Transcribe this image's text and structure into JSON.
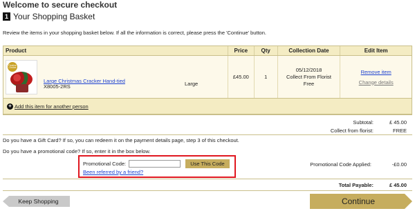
{
  "page": {
    "title": "Welcome to secure checkout",
    "step_number": "1",
    "step_title": "Your Shopping Basket",
    "intro": "Review the items in your shopping basket below. If all the information is correct, please press the 'Continue' button."
  },
  "table": {
    "headers": {
      "product": "Product",
      "price": "Price",
      "qty": "Qty",
      "date": "Collection Date",
      "edit": "Edit Item"
    },
    "item": {
      "name": "Large Christmas Cracker Hand-tied",
      "code": "X8005-2RS",
      "size": "Large",
      "price": "£45.00",
      "qty": "1",
      "date_line1": "05/12/2018",
      "date_line2": "Collect From Florist",
      "date_line3": "Free",
      "remove": "Remove item",
      "change": "Change details",
      "image_badge": "Festive Choice"
    },
    "add_for_person": "Add this item for another person"
  },
  "summary": {
    "subtotal_label": "Subtotal:",
    "subtotal_value": "£ 45.00",
    "collect_label": "Collect from florist:",
    "collect_value": "FREE",
    "promo_applied_label": "Promotional Code Applied:",
    "promo_applied_value": "-£0.00",
    "total_label": "Total Payable:",
    "total_value": "£ 45.00"
  },
  "gift_card_text": "Do you have a Gift Card? If so, you can redeem it on the payment details page, step 3 of this checkout.",
  "promo": {
    "question": "Do you have a promotional code? If so, enter it in the box below.",
    "label": "Promotional Code:",
    "input_value": "",
    "button": "Use This Code",
    "referred": "Been referred by a friend?"
  },
  "buttons": {
    "keep_shopping": "Keep Shopping",
    "continue": "Continue"
  },
  "colors": {
    "gold": "#c6ad5e",
    "highlight_border": "#e0161e",
    "link": "#1a3fd0"
  }
}
